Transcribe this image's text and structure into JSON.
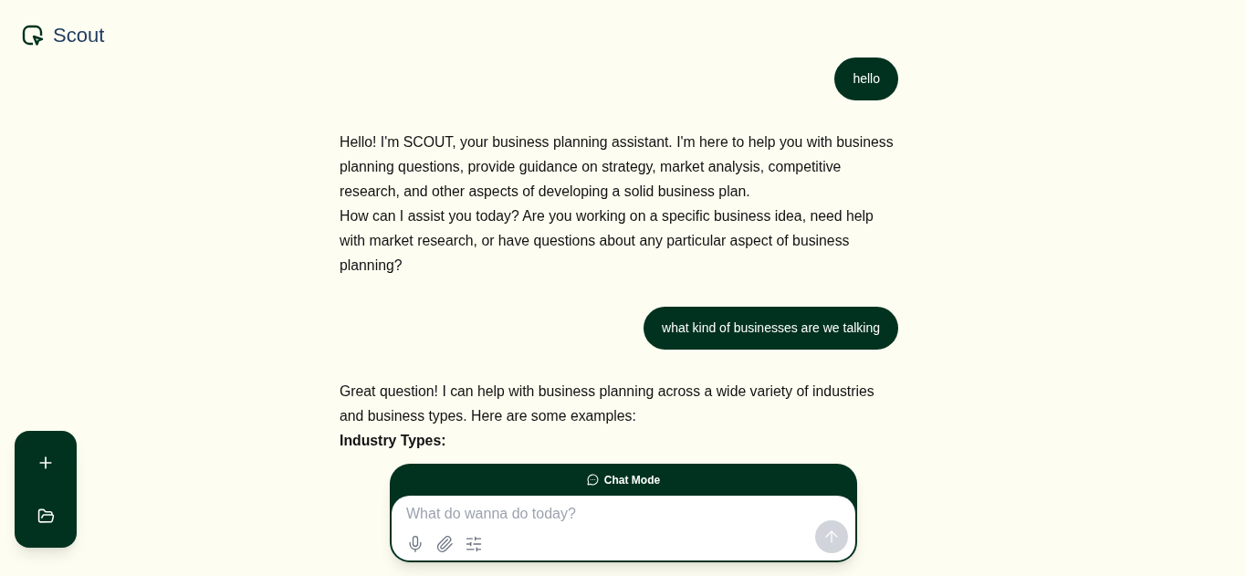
{
  "brand": {
    "name": "Scout"
  },
  "messages": [
    {
      "kind": "user",
      "text": "hello"
    },
    {
      "kind": "assistant",
      "lines": [
        {
          "text": "Hello! I'm SCOUT, your business planning assistant. I'm here to help you with business planning questions, provide guidance on strategy, market analysis, competitive research, and other aspects of developing a solid business plan.",
          "bold": false
        },
        {
          "text": "How can I assist you today? Are you working on a specific business idea, need help with market research, or have questions about any particular aspect of business planning?",
          "bold": false
        }
      ]
    },
    {
      "kind": "user",
      "text": "what kind of businesses are we talking"
    },
    {
      "kind": "assistant",
      "lines": [
        {
          "text": "Great question! I can help with business planning across a wide variety of industries and business types. Here are some examples:",
          "bold": false
        },
        {
          "text": "Industry Types:",
          "bold": true
        }
      ]
    }
  ],
  "composer": {
    "mode": "Chat Mode",
    "placeholder": "What do wanna do today?"
  }
}
